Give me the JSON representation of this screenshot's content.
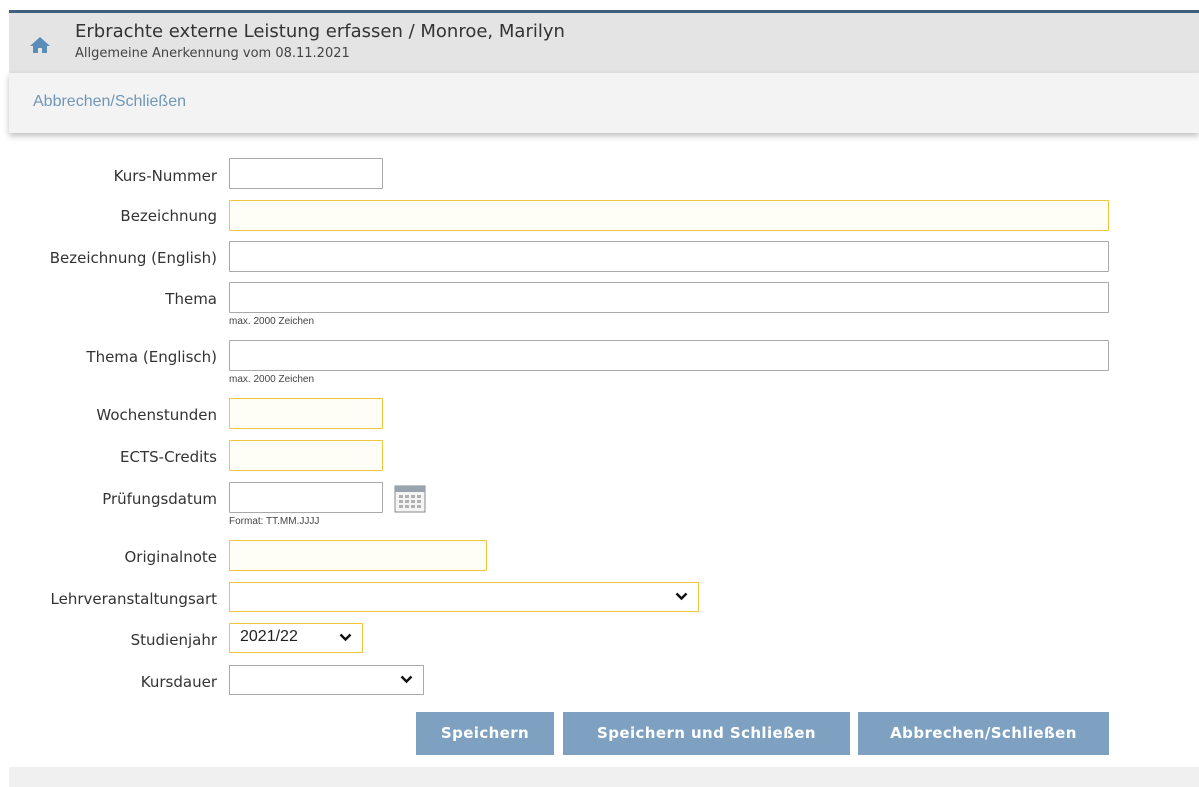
{
  "header": {
    "title": "Erbrachte externe Leistung erfassen  / Monroe, Marilyn",
    "subtitle": "Allgemeine Anerkennung vom 08.11.2021",
    "home_icon": "home-icon",
    "border_color": "#3f5f7c"
  },
  "actionbar": {
    "link": "Abbrechen/Schließen",
    "link_color": "#6f96b7"
  },
  "form": {
    "kurs_nummer": {
      "label": "Kurs-Nummer",
      "value": ""
    },
    "bezeichnung": {
      "label": "Bezeichnung",
      "value": ""
    },
    "bezeichnung_en": {
      "label": "Bezeichnung (English)",
      "value": ""
    },
    "thema": {
      "label": "Thema",
      "value": "",
      "hint": "max. 2000 Zeichen"
    },
    "thema_en": {
      "label": "Thema (Englisch)",
      "value": "",
      "hint": "max. 2000 Zeichen"
    },
    "wochenstunden": {
      "label": "Wochenstunden",
      "value": ""
    },
    "ects": {
      "label": "ECTS-Credits",
      "value": ""
    },
    "pruefungsdatum": {
      "label": "Prüfungsdatum",
      "value": "",
      "hint": "Format: TT.MM.JJJJ",
      "icon": "calendar-icon"
    },
    "originalnote": {
      "label": "Originalnote",
      "value": ""
    },
    "lehrveranstaltungsart": {
      "label": "Lehrveranstaltungsart",
      "selected": ""
    },
    "studienjahr": {
      "label": "Studienjahr",
      "selected": "2021/22"
    },
    "kursdauer": {
      "label": "Kursdauer",
      "selected": ""
    }
  },
  "buttons": {
    "save": "Speichern",
    "save_close": "Speichern und Schließen",
    "cancel_close": "Abbrechen/Schließen",
    "color": "#7ea1c2"
  },
  "colors": {
    "required_border": "#f0c73c"
  }
}
